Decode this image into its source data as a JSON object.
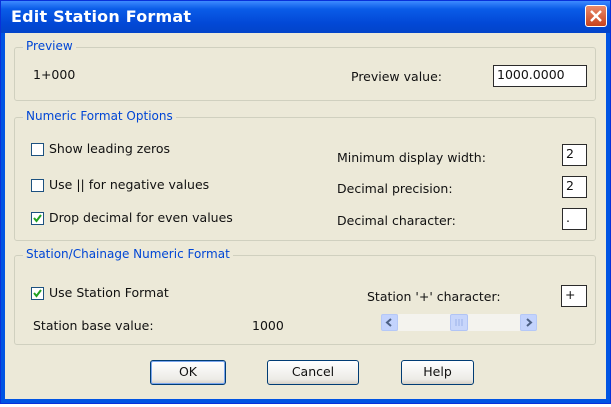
{
  "window": {
    "title": "Edit Station Format"
  },
  "preview": {
    "group_label": "Preview",
    "sample_text": "1+000",
    "value_label": "Preview value:",
    "value": "1000.0000"
  },
  "numeric": {
    "group_label": "Numeric Format Options",
    "show_leading_zeros": {
      "label": "Show leading zeros",
      "checked": false
    },
    "use_parens_negative": {
      "label": "Use || for negative values",
      "checked": false
    },
    "drop_decimal": {
      "label": "Drop decimal for even values",
      "checked": true
    },
    "min_display_width_label": "Minimum display width:",
    "min_display_width": "2",
    "decimal_precision_label": "Decimal precision:",
    "decimal_precision": "2",
    "decimal_character_label": "Decimal character:",
    "decimal_character": "."
  },
  "station": {
    "group_label": "Station/Chainage Numeric Format",
    "use_station_format": {
      "label": "Use Station Format",
      "checked": true
    },
    "plus_char_label": "Station '+' character:",
    "plus_char": "+",
    "base_value_label": "Station base value:",
    "base_value": "1000",
    "slider": {
      "position": 0.5
    }
  },
  "buttons": {
    "ok": "OK",
    "cancel": "Cancel",
    "help": "Help"
  },
  "colors": {
    "title_blue": "#0054e3",
    "group_label": "#0046d5",
    "dialog_bg": "#ece9d8"
  }
}
